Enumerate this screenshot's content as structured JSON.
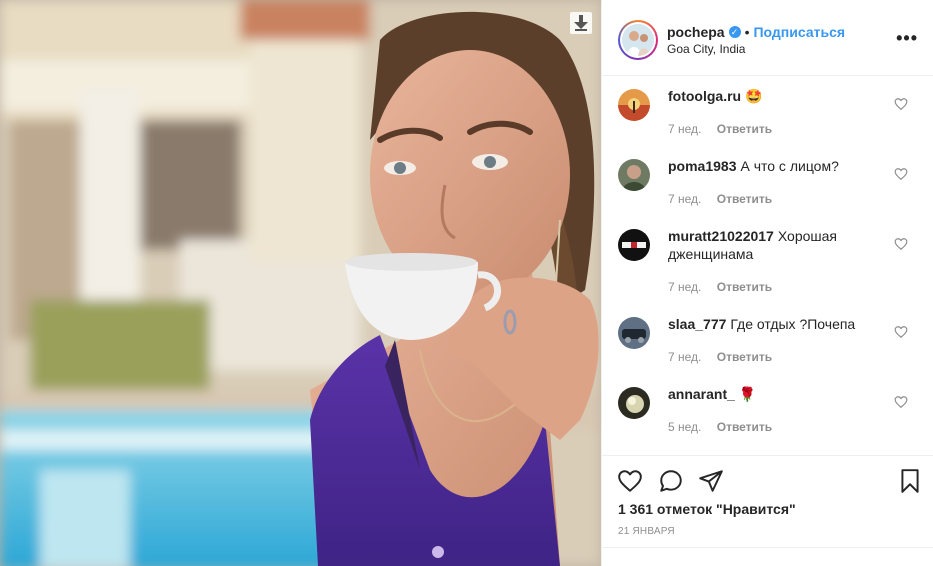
{
  "post": {
    "photo_icon": "download-arrow-icon"
  },
  "header": {
    "username": "pochepa",
    "verified_icon": "verified-badge-icon",
    "separator": "•",
    "follow_label": "Подписаться",
    "location": "Goa City, India",
    "more_label": "•••"
  },
  "comments": [
    {
      "user": "fotoolga.ru",
      "text": "🤩",
      "age": "7 нед.",
      "reply": "Ответить"
    },
    {
      "user": "poma1983",
      "text": "А что с лицом?",
      "age": "7 нед.",
      "reply": "Ответить"
    },
    {
      "user": "muratt21022017",
      "text": "Хорошая дженщинама",
      "age": "7 нед.",
      "reply": "Ответить"
    },
    {
      "user": "slaa_777",
      "text": "Где отдых ?Почепа",
      "age": "7 нед.",
      "reply": "Ответить"
    },
    {
      "user": "annarant_",
      "text": "🌹",
      "age": "5 нед.",
      "reply": "Ответить"
    }
  ],
  "actions": {
    "icons": [
      "heart-icon",
      "comment-icon",
      "share-icon",
      "bookmark-icon"
    ],
    "likes": "1 361 отметок \"Нравится\"",
    "date": "21 ЯНВАРЯ"
  },
  "colors": {
    "accent": "#3897f0",
    "muted": "#8e8e8e",
    "text": "#262626"
  }
}
